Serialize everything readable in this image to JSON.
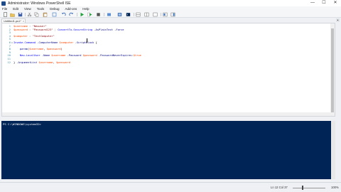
{
  "window": {
    "title": "Administrator: Windows PowerShell ISE",
    "minimize_glyph": "—",
    "maximize_glyph": "☐",
    "close_glyph": "✕"
  },
  "menu": [
    "File",
    "Edit",
    "View",
    "Tools",
    "Debug",
    "Add-ons",
    "Help"
  ],
  "toolbar": {
    "icons": [
      "new-file-icon",
      "open-icon",
      "save-icon",
      "cut-icon",
      "copy-icon",
      "paste-icon",
      "clear-icon",
      "undo-icon",
      "redo-icon",
      "run-icon",
      "run-selection-icon",
      "stop-icon",
      "debug-icon",
      "new-remote-tab-icon",
      "start-powershell-icon",
      "show-script-pane-icon",
      "show-script-right-icon",
      "show-script-max-icon",
      "show-command-icon",
      "show-addon-icon",
      "help-icon"
    ]
  },
  "tab": {
    "label": "Untitled1.ps1*",
    "close_glyph": "×",
    "scroll_glyph": "▲"
  },
  "editor": {
    "lines": [
      {
        "n": "1",
        "tokens": [
          {
            "t": "$username",
            "c": "var"
          },
          {
            "t": " = ",
            "c": "op"
          },
          {
            "t": "\"Newuser\"",
            "c": "str"
          }
        ]
      },
      {
        "n": "2",
        "tokens": [
          {
            "t": "$password",
            "c": "var"
          },
          {
            "t": " = ",
            "c": "op"
          },
          {
            "t": "\"Password123\"",
            "c": "str"
          },
          {
            "t": " | ",
            "c": "op"
          },
          {
            "t": "ConvertTo-SecureString",
            "c": "cmd"
          },
          {
            "t": " -AsPlainText",
            "c": "param"
          },
          {
            "t": " -Force",
            "c": "param"
          }
        ]
      },
      {
        "n": "3",
        "tokens": []
      },
      {
        "n": "4",
        "tokens": [
          {
            "t": "$computer",
            "c": "var"
          },
          {
            "t": " = ",
            "c": "op"
          },
          {
            "t": "\"TestComputer\"",
            "c": "str"
          }
        ]
      },
      {
        "n": "5",
        "tokens": []
      },
      {
        "n": "6",
        "fold": "⊟",
        "tokens": [
          {
            "t": "Invoke-Command",
            "c": "cmd"
          },
          {
            "t": " -ComputerName",
            "c": "param"
          },
          {
            "t": " $computer",
            "c": "var"
          },
          {
            "t": " -ScriptBlock",
            "c": "param"
          },
          {
            "t": " {",
            "c": "brace"
          }
        ]
      },
      {
        "n": "7",
        "tokens": []
      },
      {
        "n": "8",
        "tokens": [
          {
            "t": "    param",
            "c": "kw"
          },
          {
            "t": "(",
            "c": "pl"
          },
          {
            "t": "$username",
            "c": "var"
          },
          {
            "t": ", ",
            "c": "pl"
          },
          {
            "t": "$password",
            "c": "var"
          },
          {
            "t": ")",
            "c": "pl"
          }
        ]
      },
      {
        "n": "9",
        "tokens": []
      },
      {
        "n": "10",
        "tokens": [
          {
            "t": "    New-LocalUser",
            "c": "cmd"
          },
          {
            "t": " -Name",
            "c": "param"
          },
          {
            "t": " $username",
            "c": "var"
          },
          {
            "t": " -Password",
            "c": "param"
          },
          {
            "t": " $password",
            "c": "var"
          },
          {
            "t": " -PasswordNeverExpires:",
            "c": "param"
          },
          {
            "t": "$true",
            "c": "var"
          }
        ]
      },
      {
        "n": "11",
        "tokens": []
      },
      {
        "n": "12",
        "tokens": [
          {
            "t": "}",
            "c": "brace"
          },
          {
            "t": " -ArgumentList",
            "c": "param"
          },
          {
            "t": " $username",
            "c": "var"
          },
          {
            "t": ", ",
            "c": "pl"
          },
          {
            "t": "$password",
            "c": "var"
          }
        ]
      }
    ]
  },
  "console": {
    "prompt": "PS C:\\WINDOWS\\system32>"
  },
  "status": {
    "position": "Ln 12  Col 37",
    "zoom": "100%",
    "zoom_level": 1.0
  }
}
